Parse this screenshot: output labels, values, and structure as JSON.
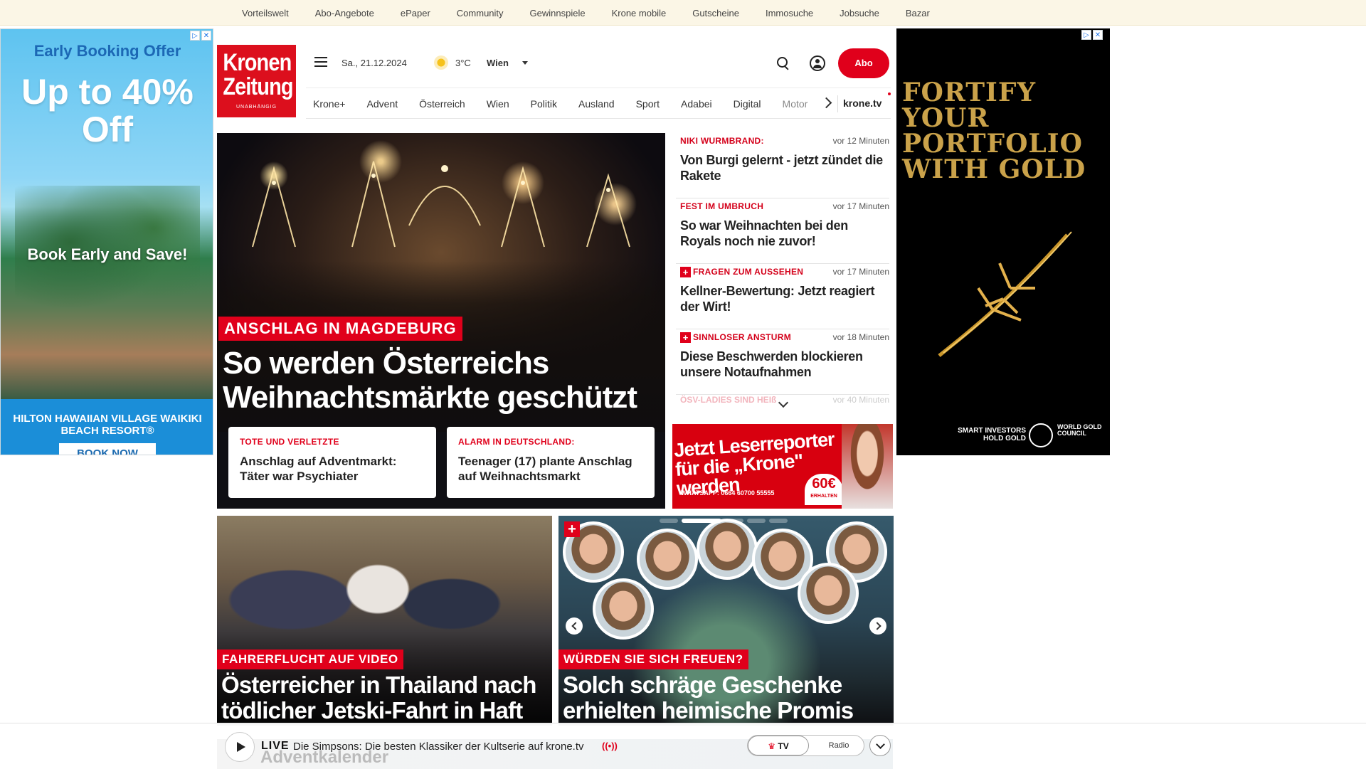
{
  "topbar": {
    "links": [
      "Vorteilswelt",
      "Abo-Angebote",
      "ePaper",
      "Community",
      "Gewinnspiele",
      "Krone mobile",
      "Gutscheine",
      "Immosuche",
      "Jobsuche",
      "Bazar"
    ]
  },
  "ads": {
    "left": {
      "headline1": "Early Booking Offer",
      "headline2": "Up to 40% Off",
      "headline3": "Book Early and Save!",
      "resort": "HILTON HAWAIIAN VILLAGE WAIKIKI BEACH RESORT®",
      "cta": "BOOK NOW"
    },
    "right": {
      "headline": "FORTIFY YOUR PORTFOLIO WITH GOLD",
      "sponsor_line": "SMART INVESTORS HOLD GOLD",
      "brand": "WORLD GOLD COUNCIL"
    }
  },
  "header": {
    "logo": {
      "line1": "Kronen",
      "line2": "Zeitung",
      "tagline": "UNABHÄNGIG"
    },
    "date": "Sa., 21.12.2024",
    "temperature": "3°C",
    "city": "Wien",
    "abo_label": "Abo",
    "nav": [
      "Krone+",
      "Advent",
      "Österreich",
      "Wien",
      "Politik",
      "Ausland",
      "Sport",
      "Adabei",
      "Digital",
      "Motor"
    ],
    "tv_link": "krone.tv"
  },
  "hero": {
    "kicker": "ANSCHLAG IN MAGDEBURG",
    "title": "So werden Österreichs Weihnachtsmärkte geschützt",
    "subcards": [
      {
        "kicker": "TOTE UND VERLETZTE",
        "title": "Anschlag auf Adventmarkt: Täter war Psychiater"
      },
      {
        "kicker": "ALARM IN DEUTSCHLAND:",
        "title": "Teenager (17) plante Anschlag auf Weihnachtsmarkt"
      }
    ]
  },
  "ticker": {
    "items": [
      {
        "kicker": "NIKI WURMBRAND:",
        "time": "vor 12 Minuten",
        "title": "Von Burgi gelernt - jetzt zündet die Rakete",
        "plus": false
      },
      {
        "kicker": "FEST IM UMBRUCH",
        "time": "vor 17 Minuten",
        "title": "So war Weihnachten bei den Royals noch nie zuvor!",
        "plus": false
      },
      {
        "kicker": "FRAGEN ZUM AUSSEHEN",
        "time": "vor 17 Minuten",
        "title": "Kellner-Bewertung: Jetzt reagiert der Wirt!",
        "plus": true
      },
      {
        "kicker": "SINNLOSER ANSTURM",
        "time": "vor 18 Minuten",
        "title": "Diese Beschwerden blockieren unsere Notaufnahmen",
        "plus": true
      }
    ],
    "faded": {
      "kicker": "ÖSV-LADIES SIND HEIß",
      "time": "vor 40 Minuten"
    }
  },
  "reporter_ad": {
    "title": "Jetzt Leserreporter für die „Krone\" werden",
    "whatsapp": "WHATSAPP: 0664 60700 55555",
    "amount": "60€",
    "amount_label": "ERHALTEN"
  },
  "cards": [
    {
      "kicker": "FAHRERFLUCHT AUF VIDEO",
      "title": "Österreicher in Thailand nach tödlicher Jetski-Fahrt in Haft"
    },
    {
      "kicker": "WÜRDEN SIE SICH FREUEN?",
      "title": "Solch schräge Geschenke erhielten heimische Promis"
    }
  ],
  "livebar": {
    "live": "LIVE",
    "text": "Die Simpsons: Die besten Klassiker der Kultserie auf krone.tv",
    "tv": "TV",
    "radio": "Radio",
    "behind": "Adventkalender"
  },
  "colors": {
    "brand_red": "#e0001b",
    "topbar_bg": "#fbf6e6"
  }
}
